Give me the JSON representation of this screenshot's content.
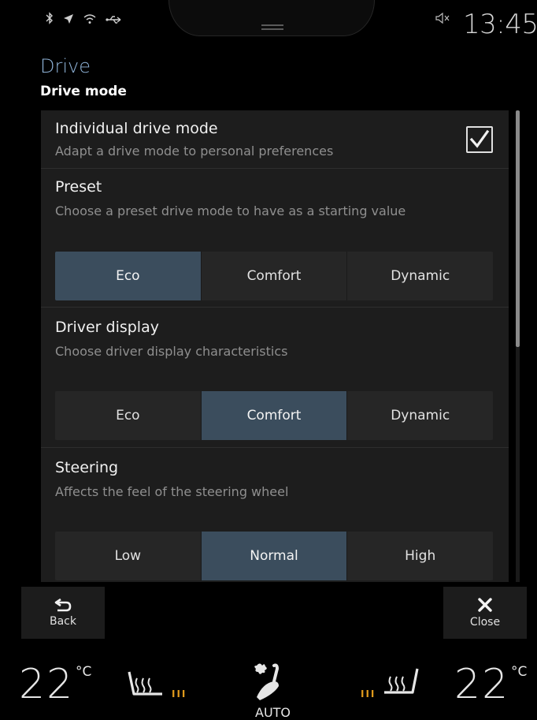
{
  "status_bar": {
    "icons": [
      "bluetooth-icon",
      "location-arrow-icon",
      "wifi-icon",
      "usb-icon"
    ],
    "muted_icon": "speaker-muted-icon",
    "time": "13:45"
  },
  "header": {
    "title": "Drive",
    "subtitle": "Drive mode"
  },
  "settings": {
    "individual": {
      "title": "Individual drive mode",
      "description": "Adapt a drive mode to personal preferences",
      "checked": true
    },
    "preset": {
      "title": "Preset",
      "description": "Choose a preset drive mode to have as a starting value",
      "options": [
        "Eco",
        "Comfort",
        "Dynamic"
      ],
      "selected": "Eco"
    },
    "driver_display": {
      "title": "Driver display",
      "description": "Choose driver display characteristics",
      "options": [
        "Eco",
        "Comfort",
        "Dynamic"
      ],
      "selected": "Comfort"
    },
    "steering": {
      "title": "Steering",
      "description": "Affects the feel of the steering wheel",
      "options": [
        "Low",
        "Normal",
        "High"
      ],
      "selected": "Normal"
    }
  },
  "nav": {
    "back_label": "Back",
    "close_label": "Close"
  },
  "climate": {
    "left_temp": "22",
    "right_temp": "22",
    "unit": "°C",
    "left_seat_heat": "III",
    "right_seat_heat": "III",
    "fan_mode": "AUTO"
  },
  "colors": {
    "accent_blue": "#8fb3d8",
    "selected_segment": "#3b4d5d",
    "heat_orange": "#e09a1c"
  }
}
